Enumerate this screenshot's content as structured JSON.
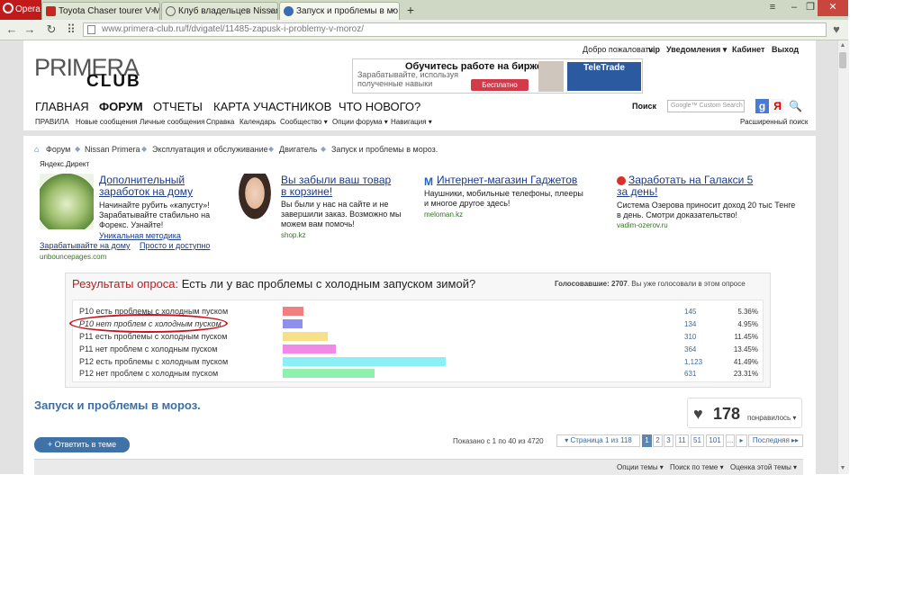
{
  "browser": {
    "opera_label": "Opera",
    "tabs": [
      {
        "label": "Toyota Chaser tourer V М"
      },
      {
        "label": "Клуб владельцев Nissan"
      },
      {
        "label": "Запуск и проблемы в мо"
      }
    ],
    "url": "www.primera-club.ru/f/dvigatel/11485-zapusk-i-problemy-v-moroz/"
  },
  "site": {
    "logo_top": "PRIMERA",
    "logo_bottom": "CLUB",
    "welcome": "Добро пожаловать,",
    "user": "vip",
    "notifications": "Уведомления ▾",
    "cabinet": "Кабинет",
    "logout": "Выход",
    "banner": {
      "title": "Обучитесь работе на бирже",
      "text": "Зарабатывайте, используя полученные навыки",
      "button": "Бесплатно",
      "brand": "TeleTrade"
    },
    "nav": [
      "ГЛАВНАЯ",
      "ФОРУМ",
      "ОТЧЕТЫ",
      "КАРТА УЧАСТНИКОВ",
      "ЧТО НОВОГО?"
    ],
    "subnav": [
      "ПРАВИЛА",
      "Новые сообщения",
      "Личные сообщения",
      "Справка",
      "Календарь",
      "Сообщество ▾",
      "Опции форума ▾",
      "Навигация ▾"
    ],
    "search_label": "Поиск",
    "search_placeholder": "Google™ Custom Search",
    "advanced_search": "Расширенный поиск"
  },
  "breadcrumb": [
    "Форум",
    "Nissan Primera",
    "Эксплуатация и обслуживание",
    "Двигатель",
    "Запуск и проблемы в мороз."
  ],
  "ads": {
    "label": "Яндекс.Директ",
    "items": [
      {
        "title": "Дополнительный заработок на дому",
        "text": "Начинайте рубить «капусту»! Зарабатывайте стабильно на Форекс. Узнайте!",
        "link1": "Уникальная методика",
        "link2": "Зарабатывайте на дому",
        "link3": "Просто и доступно",
        "source": "unbouncepages.com"
      },
      {
        "title": "Вы забыли ваш товар в корзине!",
        "text": "Вы были у нас на сайте и не завершили заказ. Возможно мы можем вам помочь!",
        "source": "shop.kz"
      },
      {
        "title": "Интернет-магазин Гаджетов",
        "text": "Наушники, мобильные телефоны, плееры и многое другое здесь!",
        "source": "meloman.kz"
      },
      {
        "title": "Заработать на Галакси 5 за день!",
        "text": "Система Озерова приносит доход 20 тыс Тенге в день. Смотри доказательство!",
        "source": "vadim-ozerov.ru"
      }
    ]
  },
  "poll": {
    "title_prefix": "Результаты опроса:",
    "question": "Есть ли у вас проблемы с холодным запуском зимой?",
    "voted_label": "Голосовавшие:",
    "voted_count": "2707",
    "voted_note": ". Вы уже голосовали в этом опросе",
    "options": [
      {
        "label": "P10 есть проблемы с холодным пуском",
        "count": "145",
        "pct": "5.36%",
        "frac": 0.0536,
        "color": "#f08080"
      },
      {
        "label": "P10 нет проблем с холодным пуском",
        "count": "134",
        "pct": "4.95%",
        "frac": 0.0495,
        "color": "#8f8ff0"
      },
      {
        "label": "P11 есть проблемы с холодным пуском",
        "count": "310",
        "pct": "11.45%",
        "frac": 0.1145,
        "color": "#f6e08a"
      },
      {
        "label": "P11 нет проблем с холодным пуском",
        "count": "364",
        "pct": "13.45%",
        "frac": 0.1345,
        "color": "#f08ae6"
      },
      {
        "label": "P12 есть проблемы с холодным пуском",
        "count": "1,123",
        "pct": "41.49%",
        "frac": 0.4149,
        "color": "#8af0f6"
      },
      {
        "label": "P12 нет проблем с холодным пуском",
        "count": "631",
        "pct": "23.31%",
        "frac": 0.2331,
        "color": "#8ff0b0"
      }
    ]
  },
  "thread": {
    "title": "Запуск и проблемы в мороз.",
    "likes": "178",
    "likes_label": "понравилось ▾",
    "reply_button": "+ Ответить в теме",
    "shown": "Показано с 1 по 40 из 4720",
    "page_of": "▾ Страница 1 из 118",
    "pages": [
      "1",
      "2",
      "3",
      "11",
      "51",
      "101"
    ],
    "more": "...",
    "next": "▸",
    "last": "Последняя ▸▸",
    "tools": [
      "Опции темы ▾",
      "Поиск по теме ▾",
      "Оценка этой темы ▾"
    ]
  }
}
